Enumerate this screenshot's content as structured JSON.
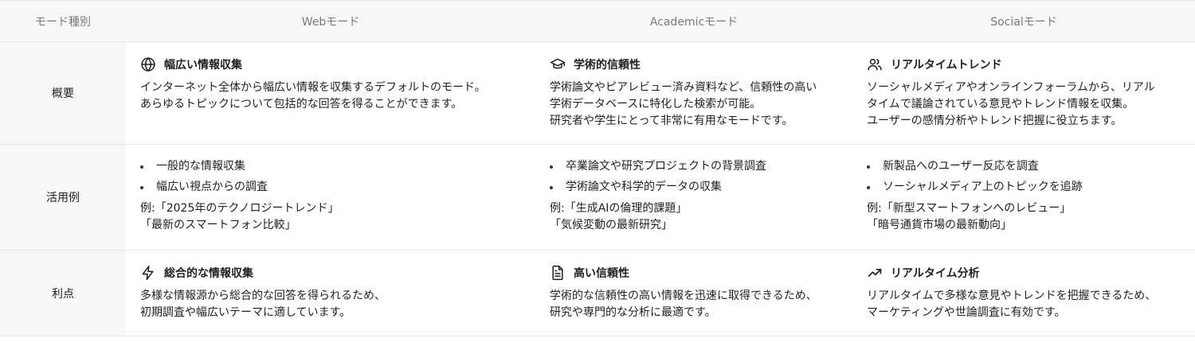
{
  "header": {
    "col0": "モード種別",
    "col1": "Webモード",
    "col2": "Academicモード",
    "col3": "Socialモード"
  },
  "rows": [
    {
      "label": "概要",
      "web": {
        "icon": "globe-icon",
        "title": "幅広い情報収集",
        "lines": [
          "インターネット全体から幅広い情報を収集するデフォルトのモード。",
          "あらゆるトピックについて包括的な回答を得ることができます。"
        ]
      },
      "academic": {
        "icon": "graduation-cap-icon",
        "title": "学術的信頼性",
        "lines": [
          "学術論文やピアレビュー済み資料など、信頼性の高い",
          "学術データベースに特化した検索が可能。",
          "研究者や学生にとって非常に有用なモードです。"
        ]
      },
      "social": {
        "icon": "users-icon",
        "title": "リアルタイムトレンド",
        "lines": [
          "ソーシャルメディアやオンラインフォーラムから、リアル",
          "タイムで議論されている意見やトレンド情報を収集。",
          "ユーザーの感情分析やトレンド把握に役立ちます。"
        ]
      }
    },
    {
      "label": "活用例",
      "web": {
        "bullets": [
          "一般的な情報収集",
          "幅広い視点からの調査"
        ],
        "examples": [
          "例:「2025年のテクノロジートレンド」",
          "「最新のスマートフォン比較」"
        ]
      },
      "academic": {
        "bullets": [
          "卒業論文や研究プロジェクトの背景調査",
          "学術論文や科学的データの収集"
        ],
        "examples": [
          "例:「生成AIの倫理的課題」",
          "「気候変動の最新研究」"
        ]
      },
      "social": {
        "bullets": [
          "新製品へのユーザー反応を調査",
          "ソーシャルメディア上のトピックを追跡"
        ],
        "examples": [
          "例:「新型スマートフォンへのレビュー」",
          "「暗号通貨市場の最新動向」"
        ]
      }
    },
    {
      "label": "利点",
      "web": {
        "icon": "zap-icon",
        "title": "総合的な情報収集",
        "lines": [
          "多様な情報源から総合的な回答を得られるため、",
          "初期調査や幅広いテーマに適しています。"
        ]
      },
      "academic": {
        "icon": "document-icon",
        "title": "高い信頼性",
        "lines": [
          "学術的な信頼性の高い情報を迅速に取得できるため、",
          "研究や専門的な分析に最適です。"
        ]
      },
      "social": {
        "icon": "trending-up-icon",
        "title": "リアルタイム分析",
        "lines": [
          "リアルタイムで多様な意見やトレンドを把握できるため、",
          "マーケティングや世論調査に有効です。"
        ]
      }
    }
  ]
}
